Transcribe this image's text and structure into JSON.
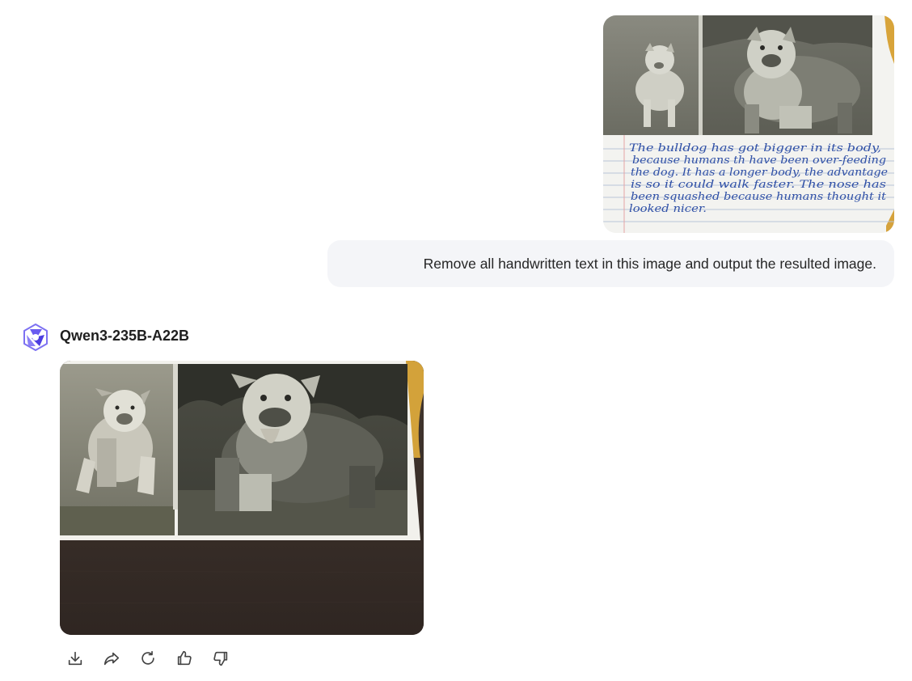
{
  "user_message": {
    "image": {
      "description_icon": "photo-attachment",
      "handwriting_lines": [
        "The bulldog has got bigger in its body,",
        "because humans th have been over-feeding",
        "the dog. It has a longer body, the advantage",
        "is so it could walk faster. The nose has",
        "been squashed because humans thought it",
        "looked nicer."
      ]
    },
    "text": "Remove all handwritten text in this image and output the resulted image."
  },
  "assistant": {
    "model_name": "Qwen3-235B-A22B",
    "avatar_icon": "qwen-logo-icon",
    "image": {
      "icon": "generated-image"
    },
    "actions": [
      {
        "name": "download-icon"
      },
      {
        "name": "share-icon"
      },
      {
        "name": "regenerate-icon"
      },
      {
        "name": "thumbs-up-icon"
      },
      {
        "name": "thumbs-down-icon"
      }
    ]
  },
  "colors": {
    "bubble_bg": "#f4f5f8",
    "avatar_purple": "#6a5cf0",
    "ink_blue": "#2e4fa6"
  }
}
